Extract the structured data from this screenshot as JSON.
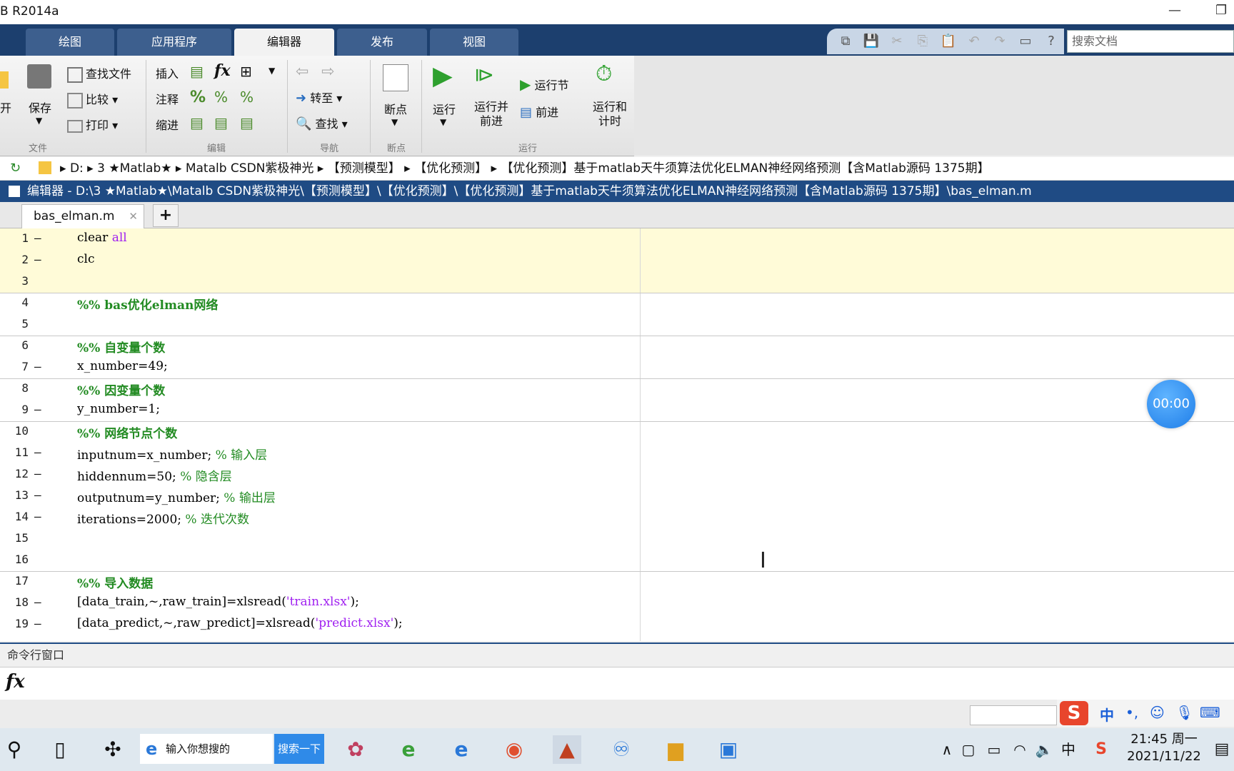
{
  "window": {
    "title": "B R2014a",
    "minimize": "—",
    "restore": "❐"
  },
  "ribbon_tabs": [
    {
      "label": "绘图"
    },
    {
      "label": "应用程序"
    },
    {
      "label": "编辑器"
    },
    {
      "label": "发布"
    },
    {
      "label": "视图"
    }
  ],
  "search_placeholder": "搜索文档",
  "ribbon": {
    "file": {
      "open": "开",
      "save": "保存",
      "find_file": "查找文件",
      "compare": "比较",
      "print": "打印",
      "group": "文件"
    },
    "edit": {
      "insert": "插入",
      "comment": "注释",
      "indent": "缩进",
      "fx": "fx",
      "group": "编辑"
    },
    "nav": {
      "goto": "转至",
      "find": "查找",
      "group": "导航"
    },
    "breakpoints": {
      "label": "断点",
      "group": "断点"
    },
    "run": {
      "run": "运行",
      "run_advance": "运行并\n前进",
      "run_section": "运行节",
      "advance": "前进",
      "run_time": "运行和\n计时",
      "group": "运行"
    }
  },
  "address": {
    "segments": [
      "D:",
      "3 ★Matlab★",
      "Matalb CSDN紫极神光",
      "【预测模型】",
      "【优化预测】",
      "【优化预测】基于matlab天牛须算法优化ELMAN神经网络预测【含Matlab源码 1375期】"
    ]
  },
  "editor_title": "编辑器 - D:\\3 ★Matlab★\\Matalb CSDN紫极神光\\【预测模型】\\【优化预测】\\【优化预测】基于matlab天牛须算法优化ELMAN神经网络预测【含Matlab源码 1375期】\\bas_elman.m",
  "file_tab": {
    "name": "bas_elman.m",
    "close": "✕",
    "add": "+"
  },
  "code_lines": [
    {
      "n": "1",
      "dash": "–",
      "parts": [
        {
          "t": "clear ",
          "c": ""
        },
        {
          "t": "all",
          "c": "kw"
        }
      ]
    },
    {
      "n": "2",
      "dash": "–",
      "parts": [
        {
          "t": "clc",
          "c": ""
        }
      ]
    },
    {
      "n": "3",
      "dash": "",
      "parts": []
    },
    {
      "n": "4",
      "dash": "",
      "parts": [
        {
          "t": "%% bas优化elman网络",
          "c": "cell"
        }
      ]
    },
    {
      "n": "5",
      "dash": "",
      "parts": []
    },
    {
      "n": "6",
      "dash": "",
      "parts": [
        {
          "t": "%% 自变量个数",
          "c": "cell"
        }
      ]
    },
    {
      "n": "7",
      "dash": "–",
      "parts": [
        {
          "t": "x_number=49;",
          "c": ""
        }
      ]
    },
    {
      "n": "8",
      "dash": "",
      "parts": [
        {
          "t": "%% 因变量个数",
          "c": "cell"
        }
      ]
    },
    {
      "n": "9",
      "dash": "–",
      "parts": [
        {
          "t": "y_number=1;",
          "c": ""
        }
      ]
    },
    {
      "n": "10",
      "dash": "",
      "parts": [
        {
          "t": "%% 网络节点个数",
          "c": "cell"
        }
      ]
    },
    {
      "n": "11",
      "dash": "–",
      "parts": [
        {
          "t": "inputnum=x_number; ",
          "c": ""
        },
        {
          "t": "% 输入层",
          "c": "com"
        }
      ]
    },
    {
      "n": "12",
      "dash": "–",
      "parts": [
        {
          "t": "hiddennum=50; ",
          "c": ""
        },
        {
          "t": "% 隐含层",
          "c": "com"
        }
      ]
    },
    {
      "n": "13",
      "dash": "–",
      "parts": [
        {
          "t": "outputnum=y_number; ",
          "c": ""
        },
        {
          "t": "% 输出层",
          "c": "com"
        }
      ]
    },
    {
      "n": "14",
      "dash": "–",
      "parts": [
        {
          "t": "iterations=2000; ",
          "c": ""
        },
        {
          "t": "% 迭代次数",
          "c": "com"
        }
      ]
    },
    {
      "n": "15",
      "dash": "",
      "parts": []
    },
    {
      "n": "16",
      "dash": "",
      "parts": []
    },
    {
      "n": "17",
      "dash": "",
      "parts": [
        {
          "t": "%% 导入数据",
          "c": "cell"
        }
      ]
    },
    {
      "n": "18",
      "dash": "–",
      "parts": [
        {
          "t": "[data_train,~,raw_train]=xlsread(",
          "c": ""
        },
        {
          "t": "'train.xlsx'",
          "c": "str"
        },
        {
          "t": ");",
          "c": ""
        }
      ]
    },
    {
      "n": "19",
      "dash": "–",
      "parts": [
        {
          "t": "[data_predict,~,raw_predict]=xlsread(",
          "c": ""
        },
        {
          "t": "'predict.xlsx'",
          "c": "str"
        },
        {
          "t": ");",
          "c": ""
        }
      ]
    }
  ],
  "timer": "00:00",
  "command_window": {
    "title": "命令行窗口",
    "prompt_icon": "fx"
  },
  "taskbar": {
    "search_placeholder": "输入你想搜的",
    "search_button": "搜索一下",
    "time": "21:45 周一",
    "date": "2021/11/22",
    "ime_lang": "中"
  },
  "colors": {
    "accent": "#1f4b84",
    "keyword": "#a020f0",
    "comment": "#228b22",
    "cell_highlight": "#fffbd8"
  }
}
